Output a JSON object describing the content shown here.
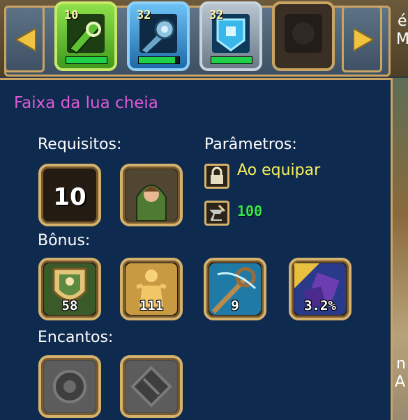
{
  "item_bar": {
    "slots": [
      {
        "level": "10",
        "progress": 1.0,
        "color": "#7bd63a"
      },
      {
        "level": "32",
        "progress": 0.9,
        "color": "#4aa6e8"
      },
      {
        "level": "32",
        "progress": 1.0,
        "color": "#9aa6b4"
      },
      {
        "level": "",
        "progress": 0,
        "color": "#8a7550"
      }
    ]
  },
  "item": {
    "name": "Faixa da lua cheia",
    "name_color": "#e05ad8"
  },
  "requirements": {
    "heading": "Requisitos:",
    "level": "10"
  },
  "parameters": {
    "heading": "Parâmetros:",
    "bind_text": "Ao equipar",
    "durability": "100"
  },
  "bonus": {
    "heading": "Bônus:",
    "values": [
      "58",
      "111",
      "9",
      "3.2%"
    ]
  },
  "enchants": {
    "heading": "Encantos:"
  },
  "edge_text": {
    "top_right_1": "é",
    "top_right_2": "M",
    "bottom_right_1": "n",
    "bottom_right_2": "A"
  }
}
